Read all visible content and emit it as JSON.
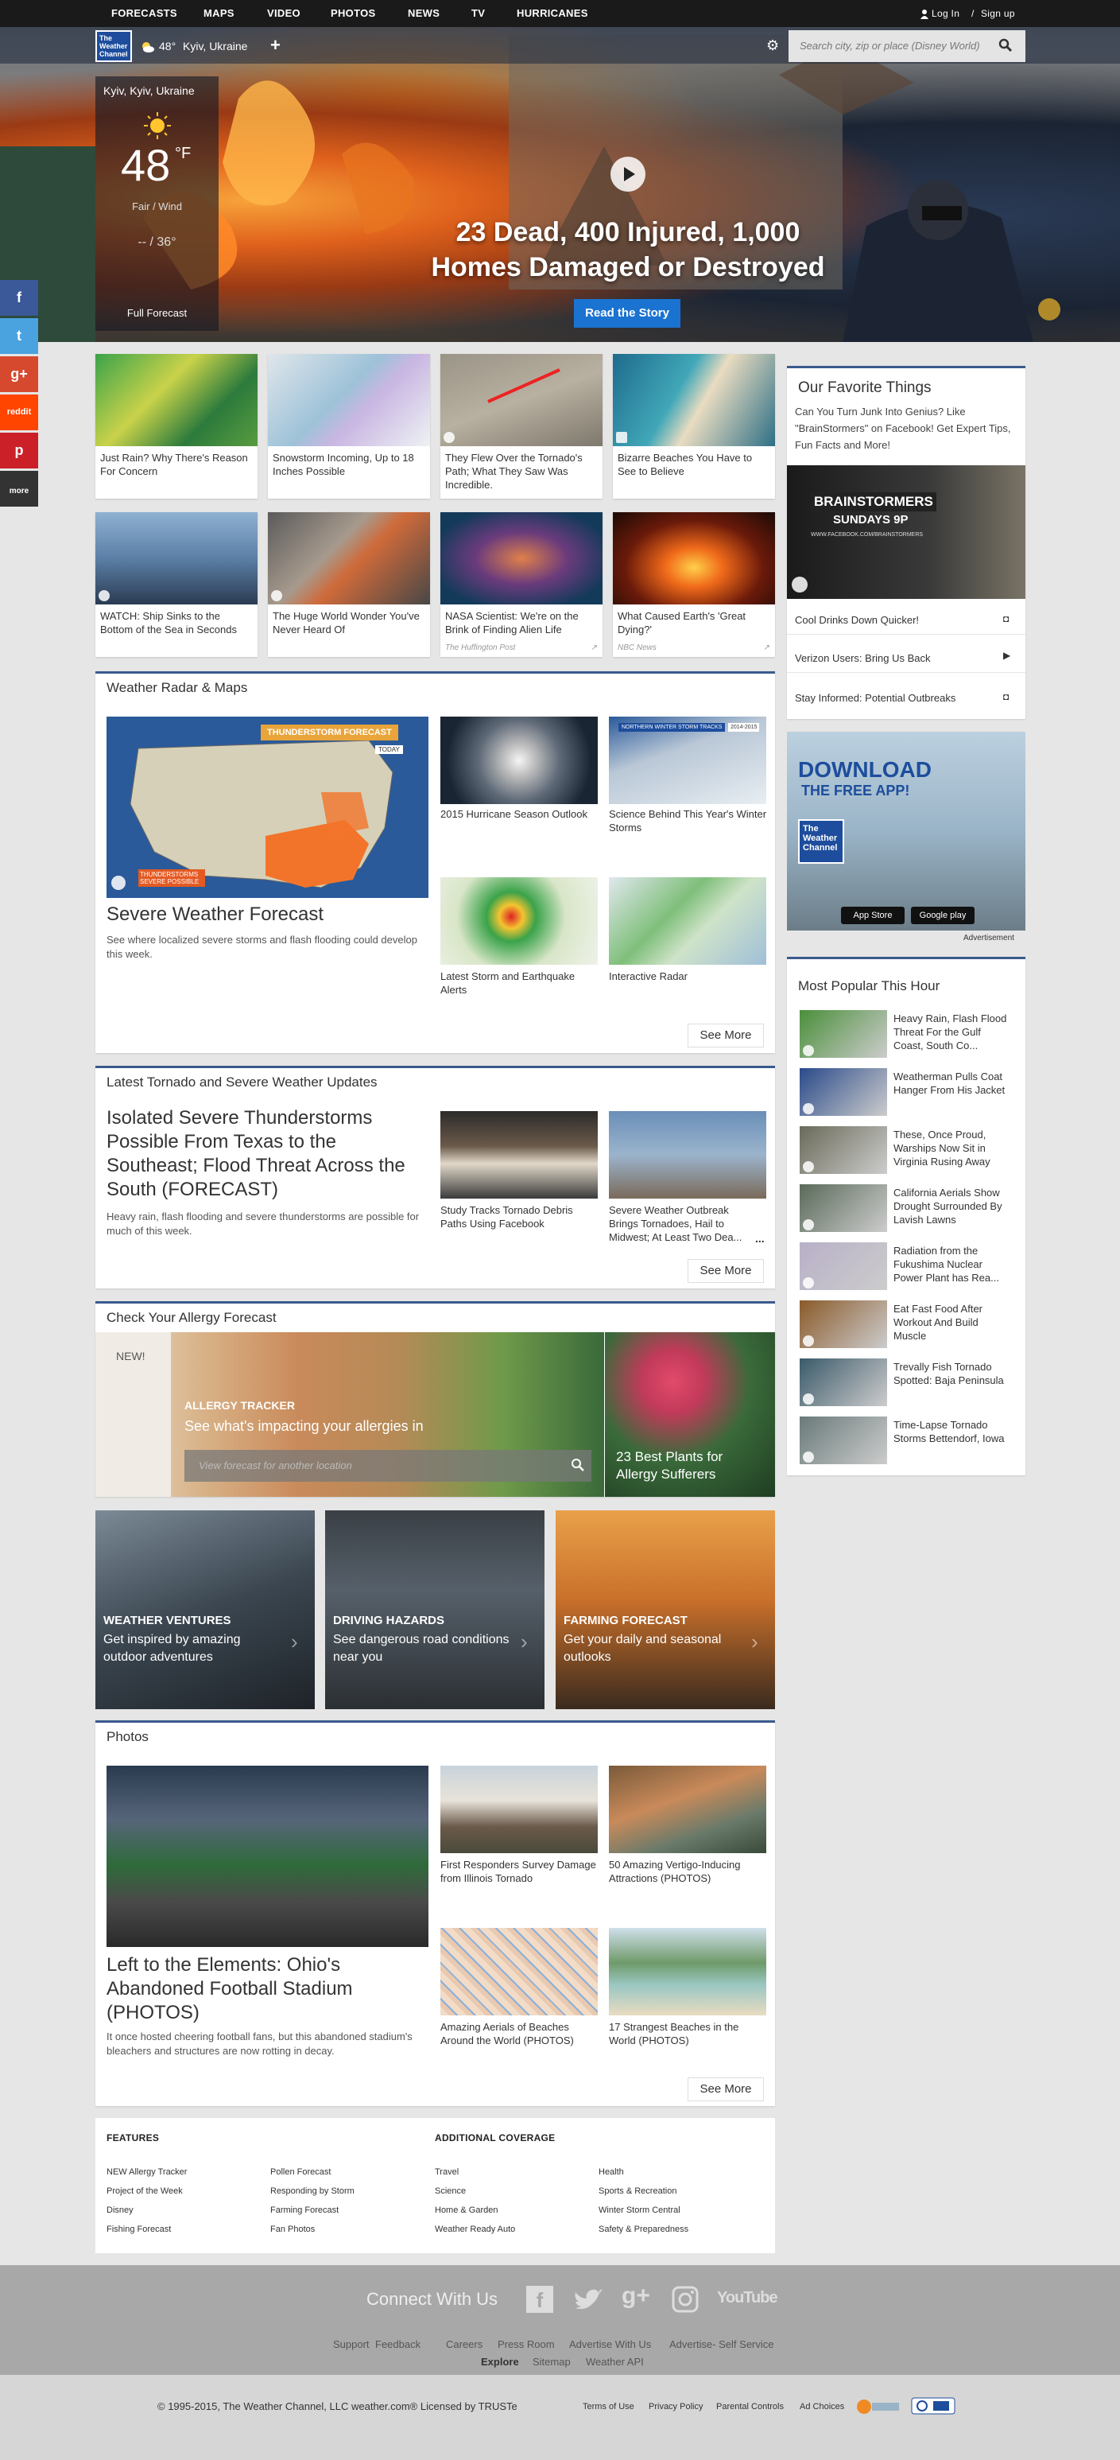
{
  "nav": {
    "items": [
      "FORECASTS",
      "MAPS",
      "VIDEO",
      "PHOTOS",
      "NEWS",
      "TV",
      "HURRICANES"
    ],
    "login": "Log In",
    "sep": "/",
    "signup": "Sign up"
  },
  "brand": {
    "logo": "The Weather Channel",
    "location_temp": "48°",
    "location": "Kyiv, Ukraine",
    "search_placeholder": "Search city, zip or place (Disney World)"
  },
  "current": {
    "city": "Kyiv, Kyiv, Ukraine",
    "temp": "48",
    "unit": "°F",
    "cond": "Fair / Wind",
    "hilo": "-- / 36°",
    "link": "Full Forecast"
  },
  "hero": {
    "headline": "23 Dead, 400 Injured, 1,000 Homes Damaged or Destroyed",
    "button": "Read the Story"
  },
  "social": [
    "f",
    "t",
    "g+",
    "reddit",
    "p",
    "more"
  ],
  "cards_row1": [
    {
      "cap": "Just Rain? Why There's Reason For Concern"
    },
    {
      "cap": "Snowstorm Incoming, Up to 18 Inches Possible"
    },
    {
      "cap": "They Flew Over the Tornado's Path; What They Saw Was Incredible."
    },
    {
      "cap": "Bizarre Beaches You Have to See to Believe"
    }
  ],
  "cards_row2": [
    {
      "cap": "WATCH: Ship Sinks to the Bottom of the Sea in Seconds",
      "src": ""
    },
    {
      "cap": "The Huge World Wonder You've Never Heard Of",
      "src": ""
    },
    {
      "cap": "NASA Scientist: We're on the Brink of Finding Alien Life",
      "src": "The Huffington Post"
    },
    {
      "cap": "What Caused Earth's 'Great Dying?'",
      "src": "NBC News"
    }
  ],
  "fav": {
    "title": "Our Favorite Things",
    "text": "Can You Turn Junk Into Genius? Like \"BrainStormers\" on Facebook! Get Expert Tips, Fun Facts and More!",
    "promo_title": "BRAINSTORMERS",
    "promo_sub": "SUNDAYS 9P",
    "promo_url": "WWW.FACEBOOK.COM/BRAINSTORMERS",
    "items": [
      "Cool Drinks Down Quicker!",
      "Verizon Users: Bring Us Back",
      "Stay Informed: Potential Outbreaks"
    ]
  },
  "ad": {
    "line1": "DOWNLOAD",
    "line2": "THE FREE APP!",
    "appstore": "App Store",
    "gplay": "Google play",
    "label": "Advertisement"
  },
  "radar": {
    "title": "Weather Radar & Maps",
    "badge": "THUNDERSTORM FORECAST",
    "today": "TODAY",
    "legend": "THUNDERSTORMS SEVERE POSSIBLE",
    "main_title": "Severe Weather Forecast",
    "main_desc": "See where localized severe storms and flash flooding could develop this week.",
    "thumbs": [
      "2015 Hurricane Season Outlook",
      "Science Behind This Year's Winter Storms",
      "Latest Storm and Earthquake Alerts",
      "Interactive Radar"
    ],
    "winter_label": "NORTHERN WINTER STORM TRACKS",
    "winter_years": "2014-2015",
    "see_more": "See More"
  },
  "popular": {
    "title": "Most Popular This Hour",
    "items": [
      "Heavy Rain, Flash Flood Threat For the Gulf Coast, South Co...",
      "Weatherman Pulls Coat Hanger From His Jacket",
      "These, Once Proud, Warships Now Sit in Virginia Rusing Away",
      "California Aerials Show Drought Surrounded By Lavish Lawns",
      "Radiation from the Fukushima Nuclear Power Plant has Rea...",
      "Eat Fast Food After Workout And Build Muscle",
      "Trevally Fish Tornado Spotted: Baja Peninsula",
      "Time-Lapse Tornado Storms Bettendorf, Iowa"
    ]
  },
  "tornado": {
    "title": "Latest Tornado and Severe Weather Updates",
    "main_title": "Isolated Severe Thunderstorms Possible From Texas to the Southeast; Flood Threat Across the South (FORECAST)",
    "main_desc": "Heavy rain, flash flooding and severe thunderstorms are possible for much of this week.",
    "thumbs": [
      "Study Tracks Tornado Debris Paths Using Facebook",
      "Severe Weather Outbreak Brings Tornadoes, Hail to Midwest; At Least Two Dea..."
    ],
    "ellipsis": "...",
    "see_more": "See More"
  },
  "allergy": {
    "title": "Check Your Allergy Forecast",
    "new": "NEW!",
    "tracker": "ALLERGY TRACKER",
    "tagline": "See what's impacting your allergies in",
    "placeholder": "View forecast for another location",
    "plants": "23 Best Plants for Allergy Sufferers"
  },
  "promos": [
    {
      "t": "WEATHER VENTURES",
      "d": "Get inspired by amazing outdoor adventures"
    },
    {
      "t": "DRIVING HAZARDS",
      "d": "See dangerous road conditions near you"
    },
    {
      "t": "FARMING FORECAST",
      "d": "Get your daily and seasonal outlooks"
    }
  ],
  "photos": {
    "title": "Photos",
    "main_title": "Left to the Elements: Ohio's Abandoned Football Stadium (PHOTOS)",
    "main_desc": "It once hosted cheering football fans, but this abandoned stadium's bleachers and structures are now rotting in decay.",
    "thumbs": [
      "First Responders Survey Damage from Illinois Tornado",
      "50 Amazing Vertigo-Inducing Attractions (PHOTOS)",
      "Amazing Aerials of Beaches Around the World (PHOTOS)",
      "17 Strangest Beaches in the World (PHOTOS)"
    ],
    "see_more": "See More"
  },
  "footer": {
    "features_title": "FEATURES",
    "features": [
      [
        "NEW Allergy Tracker",
        "Pollen Forecast"
      ],
      [
        "Project of the Week",
        "Responding by Storm"
      ],
      [
        "Disney",
        "Farming Forecast"
      ],
      [
        "Fishing Forecast",
        "Fan Photos"
      ]
    ],
    "coverage_title": "ADDITIONAL COVERAGE",
    "coverage": [
      [
        "Travel",
        "Health"
      ],
      [
        "Science",
        "Sports & Recreation"
      ],
      [
        "Home & Garden",
        "Winter Storm Central"
      ],
      [
        "Weather Ready Auto",
        "Safety & Preparedness"
      ]
    ]
  },
  "connect": {
    "title": "Connect With Us",
    "youtube": "YouTube",
    "links1": [
      "Support",
      "Feedback",
      "Careers",
      "Press Room",
      "Advertise With Us",
      "Advertise- Self Service"
    ],
    "links2": [
      "Explore",
      "Sitemap",
      "Weather API"
    ]
  },
  "legal": {
    "copy": "© 1995-2015, The Weather Channel, LLC weather.com® Licensed by TRUSTe",
    "links": [
      "Terms of Use",
      "Privacy Policy",
      "Parental Controls",
      "Ad Choices"
    ]
  }
}
